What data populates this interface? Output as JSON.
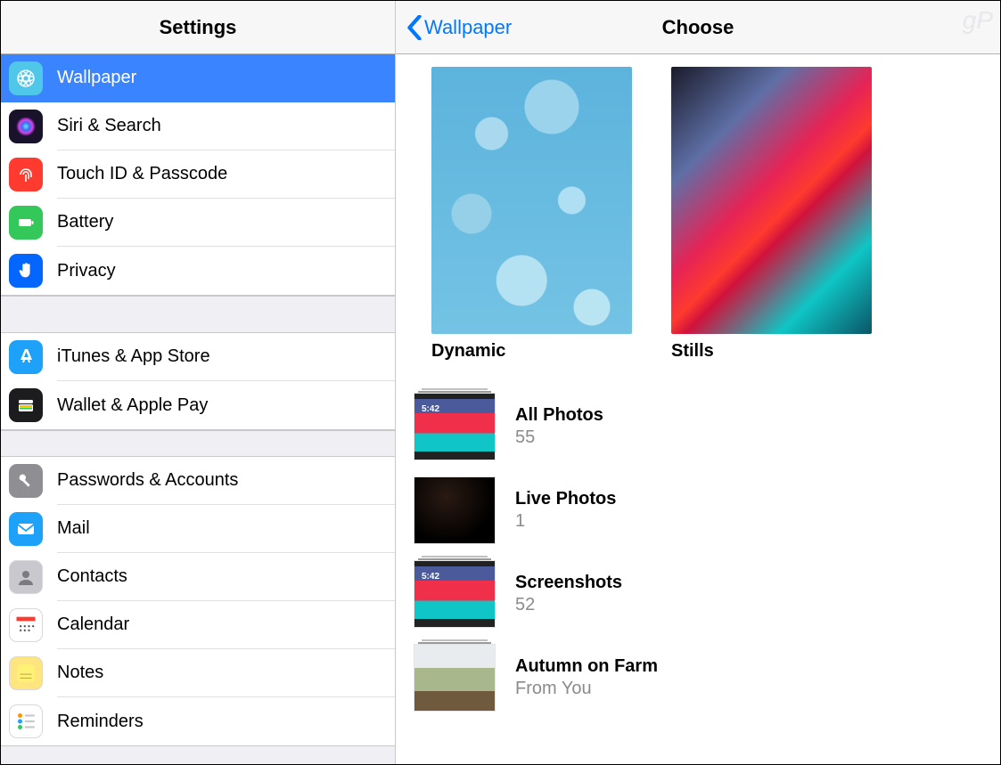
{
  "sidebar": {
    "title": "Settings",
    "groups": [
      {
        "items": [
          {
            "id": "wallpaper",
            "label": "Wallpaper",
            "icon": "wallpaper",
            "icon_bg": "#4fc7e8",
            "selected": true
          },
          {
            "id": "siri",
            "label": "Siri & Search",
            "icon": "siri",
            "icon_bg": "#18122b"
          },
          {
            "id": "touchid",
            "label": "Touch ID & Passcode",
            "icon": "fingerprint",
            "icon_bg": "#ff3b30"
          },
          {
            "id": "battery",
            "label": "Battery",
            "icon": "battery",
            "icon_bg": "#34c759"
          },
          {
            "id": "privacy",
            "label": "Privacy",
            "icon": "hand",
            "icon_bg": "#0366ff"
          }
        ]
      },
      {
        "items": [
          {
            "id": "itunes",
            "label": "iTunes & App Store",
            "icon": "appstore",
            "icon_bg": "#1da1f9"
          },
          {
            "id": "wallet",
            "label": "Wallet & Apple Pay",
            "icon": "wallet",
            "icon_bg": "#1c1c1e"
          }
        ]
      },
      {
        "items": [
          {
            "id": "passwords",
            "label": "Passwords & Accounts",
            "icon": "key",
            "icon_bg": "#8e8e93"
          },
          {
            "id": "mail",
            "label": "Mail",
            "icon": "mail",
            "icon_bg": "#1da1f9"
          },
          {
            "id": "contacts",
            "label": "Contacts",
            "icon": "contacts",
            "icon_bg": "#c9c8ce"
          },
          {
            "id": "calendar",
            "label": "Calendar",
            "icon": "calendar",
            "icon_bg": "#ffffff"
          },
          {
            "id": "notes",
            "label": "Notes",
            "icon": "notes",
            "icon_bg": "#ffe57f"
          },
          {
            "id": "reminders",
            "label": "Reminders",
            "icon": "reminders",
            "icon_bg": "#ffffff"
          }
        ]
      }
    ]
  },
  "detail": {
    "back_label": "Wallpaper",
    "title": "Choose",
    "wallpaper_categories": [
      {
        "id": "dynamic",
        "label": "Dynamic",
        "thumb_class": "bg-dynamic"
      },
      {
        "id": "stills",
        "label": "Stills",
        "thumb_class": "bg-stills"
      }
    ],
    "albums": [
      {
        "id": "all",
        "name": "All Photos",
        "count": "55",
        "thumb_class": "bg-screenshot",
        "stack": true,
        "timestamp": "5:42"
      },
      {
        "id": "live",
        "name": "Live Photos",
        "count": "1",
        "thumb_class": "bg-dark",
        "stack": false
      },
      {
        "id": "screenshots",
        "name": "Screenshots",
        "count": "52",
        "thumb_class": "bg-screenshot",
        "stack": true,
        "timestamp": "5:42"
      },
      {
        "id": "autumn",
        "name": "Autumn on Farm",
        "count": "From You",
        "thumb_class": "bg-farm",
        "stack": true
      }
    ]
  },
  "watermark": "gP"
}
